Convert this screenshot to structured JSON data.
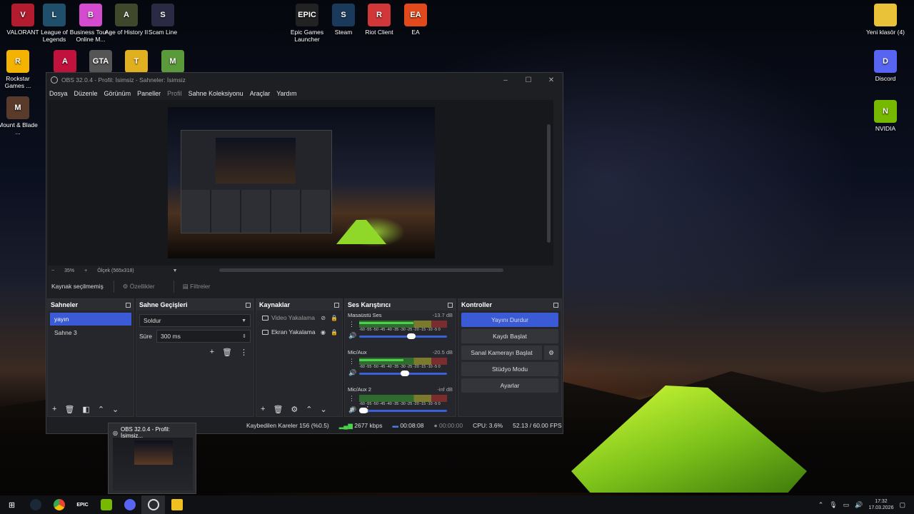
{
  "desktop": {
    "icons": [
      {
        "label": "VALORANT",
        "color": "#b31b2f",
        "glyph": "V"
      },
      {
        "label": "League of Legends",
        "color": "#1f4f6b",
        "glyph": "L"
      },
      {
        "label": "Business Tour - Online M...",
        "color": "#d44bd0",
        "glyph": "B"
      },
      {
        "label": "Age of History II",
        "color": "#40482c",
        "glyph": "A"
      },
      {
        "label": "Scam Line",
        "color": "#2a2a44",
        "glyph": "S"
      },
      {
        "label": "Epic Games Launcher",
        "color": "#222222",
        "glyph": "EPIC"
      },
      {
        "label": "Steam",
        "color": "#1a3a5c",
        "glyph": "S"
      },
      {
        "label": "Riot Client",
        "color": "#d13639",
        "glyph": "R"
      },
      {
        "label": "EA",
        "color": "#e24a1d",
        "glyph": "EA"
      },
      {
        "label": "Rockstar Games ...",
        "color": "#f5b301",
        "glyph": "R"
      },
      {
        "label": "Mount & Blade ...",
        "color": "#5a3a2a",
        "glyph": "M"
      },
      {
        "label": "Yeni klasör (4)",
        "color": "#e9c23a",
        "glyph": ""
      },
      {
        "label": "Discord",
        "color": "#5865f2",
        "glyph": "D"
      },
      {
        "label": "NVIDIA",
        "color": "#76b900",
        "glyph": "N"
      }
    ]
  },
  "obs": {
    "title": "OBS 32.0.4 - Profil: İsimsiz - Sahneler: İsimsiz",
    "menu": [
      "Dosya",
      "Düzenle",
      "Görünüm",
      "Paneller",
      "Profil",
      "Sahne Koleksiyonu",
      "Araçlar",
      "Yardım"
    ],
    "zoom": "35%",
    "scale": "Ölçek (565x318)",
    "no_source": "Kaynak seçilmemiş",
    "properties": "Özellikler",
    "filters": "Filtreler",
    "scenes": {
      "title": "Sahneler",
      "items": [
        "yayın",
        "Sahne 3"
      ]
    },
    "transitions": {
      "title": "Sahne Geçişleri",
      "type": "Soldur",
      "duration_label": "Süre",
      "duration": "300 ms"
    },
    "sources": {
      "title": "Kaynaklar",
      "items": [
        "Video Yakalama",
        "Ekran Yakalama"
      ]
    },
    "mixer": {
      "title": "Ses Karıştırıcı",
      "channels": [
        {
          "name": "Masaüstü Ses",
          "db": "-13.7 dB",
          "level": 0.62,
          "volume": 0.6
        },
        {
          "name": "Mic/Aux",
          "db": "-20.5 dB",
          "level": 0.5,
          "volume": 0.52
        },
        {
          "name": "Mic/Aux 2",
          "db": "-inf dB",
          "level": 0,
          "volume": 0.0
        }
      ],
      "ticks": "-60 -55 -50 -45 -40 -35 -30 -25 -20 -15 -10 -5 0"
    },
    "controls": {
      "title": "Kontroller",
      "buttons": [
        "Yayını Durdur",
        "Kaydı Başlat",
        "Sanal Kamerayı Başlat",
        "Stüdyo Modu",
        "Ayarlar"
      ]
    },
    "status": {
      "dropped": "Kaybedilen Kareler 156 (%0.5)",
      "bitrate": "2677 kbps",
      "stream_time": "00:08:08",
      "rec_time": "00:00:00",
      "cpu": "CPU: 3.6%",
      "fps": "52.13 / 60.00 FPS"
    }
  },
  "thumbnail": {
    "title": "OBS 32.0.4 - Profil: İsimsiz..."
  },
  "taskbar": {
    "time": "17:32",
    "date": "17.03.2026"
  }
}
